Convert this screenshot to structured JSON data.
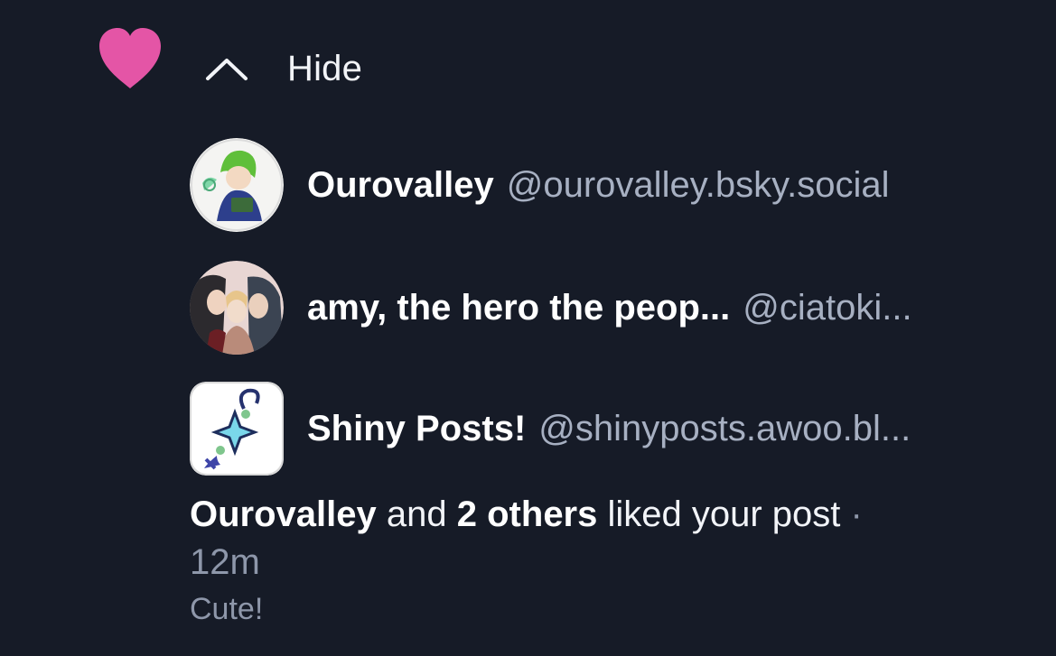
{
  "notification": {
    "hide_label": "Hide",
    "likers": [
      {
        "display_name": "Ourovalley",
        "handle": "@ourovalley.bsky.social",
        "avatar": "green-haired-mage-avatar"
      },
      {
        "display_name": "amy, the hero the peop...",
        "handle": "@ciatoki...",
        "avatar": "three-characters-avatar"
      },
      {
        "display_name": "Shiny Posts!",
        "handle": "@shinyposts.awoo.bl...",
        "avatar": "blue-star-charm-avatar"
      }
    ],
    "summary": {
      "actor": "Ourovalley",
      "connector": "and",
      "others": "2 others",
      "action": "liked your post",
      "separator": "·",
      "time": "12m"
    },
    "post_preview": "Cute!"
  },
  "colors": {
    "background": "#161b27",
    "heart": "#e455a6",
    "handle": "#a7b0c2",
    "muted": "#8e97aa"
  },
  "icons": {
    "like": "heart-icon",
    "collapse": "chevron-up-icon"
  }
}
